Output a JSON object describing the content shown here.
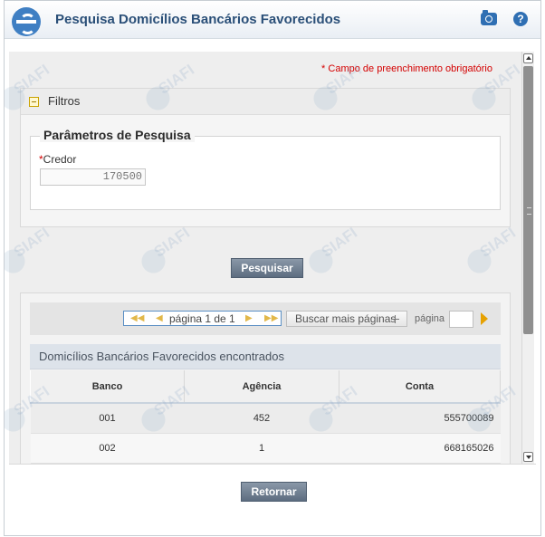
{
  "header": {
    "title": "Pesquisa Domicílios Bancários Favorecidos",
    "camera_icon": "camera-icon",
    "help_icon": "help-icon",
    "help_glyph": "?"
  },
  "required_note": "* Campo de preenchimento obrigatório",
  "filters": {
    "label": "Filtros",
    "fieldset_title": "Parâmetros de Pesquisa",
    "credor": {
      "required_mark": "*",
      "label": "Credor",
      "value": "170500"
    },
    "search_button": "Pesquisar"
  },
  "pagination": {
    "first": "◀◀",
    "prev": "◀",
    "page_text": "página 1 de 1",
    "next": "▶",
    "last": "▶▶",
    "more_button": "Buscar mais páginas",
    "page_label": "página",
    "page_input_value": ""
  },
  "results": {
    "title": "Domicílios Bancários Favorecidos encontrados",
    "columns": [
      "Banco",
      "Agência",
      "Conta"
    ],
    "rows": [
      [
        "001",
        "452",
        "555700089"
      ],
      [
        "002",
        "1",
        "668165026"
      ]
    ]
  },
  "footer": {
    "return_button": "Retornar"
  },
  "watermark": "SIAFI",
  "colors": {
    "title": "#2a4f78",
    "required": "#d40000",
    "button": "#6b7b8e"
  }
}
